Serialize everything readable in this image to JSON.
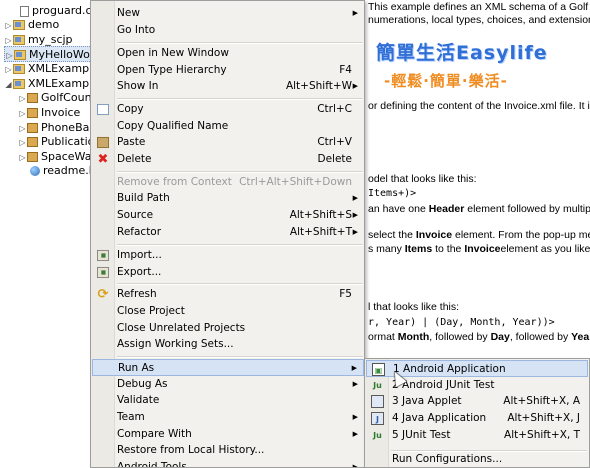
{
  "tree": {
    "items": [
      {
        "label": "proguard.cfg",
        "kind": "file"
      },
      {
        "label": "demo",
        "kind": "project",
        "twisty": "▷"
      },
      {
        "label": "my_scjp",
        "kind": "project",
        "twisty": "▷"
      },
      {
        "label": "MyHelloWorld",
        "kind": "project",
        "twisty": "▷"
      },
      {
        "label": "XMLExample",
        "kind": "project",
        "twisty": "▷"
      },
      {
        "label": "XMLExample",
        "kind": "project",
        "twisty": "◢"
      },
      {
        "label": "GolfCount",
        "kind": "package",
        "twisty": "▷"
      },
      {
        "label": "Invoice",
        "kind": "package",
        "twisty": "▷"
      },
      {
        "label": "PhoneBank",
        "kind": "package",
        "twisty": "▷"
      },
      {
        "label": "Publications",
        "kind": "package",
        "twisty": "▷"
      },
      {
        "label": "SpaceWar",
        "kind": "package",
        "twisty": "▷"
      },
      {
        "label": "readme.htm",
        "kind": "web"
      }
    ]
  },
  "editor": {
    "intro1": "This example defines an XML schema of a Golf Course",
    "intro2": "numerations, local types, choices, and extensions",
    "logo_line1": "簡單生活Easylife",
    "logo_line2": "-輕鬆·簡單·樂活-",
    "para1": "or defining the content of the Invoice.xml file. It is as",
    "para2": "odel that looks like this:",
    "code1": "Items+)>",
    "para3_pre": "an have one ",
    "para3_bold": "Header",
    "para3_post": " element followed by multiple",
    "para4_pre": "select the ",
    "para4_bold": "Invoice",
    "para4_post": " element. From the pop-up menu",
    "para5_pre": "s many ",
    "para5_bold1": "Items",
    "para5_mid": " to the ",
    "para5_bold2": "Invoice",
    "para5_post": "element as you like.",
    "para6": "l that looks like this:",
    "code2": "r, Year) | (Day, Month, Year))>",
    "para7_pre": "ormat ",
    "para7_bold1": "Month",
    "para7_mid": ", followed by ",
    "para7_bold2": "Day",
    "para7_mid2": ", followed by ",
    "para7_bold3": "Year",
    "para7_post": ","
  },
  "context_menu": {
    "items": [
      {
        "label": "New",
        "submenu": true
      },
      {
        "label": "Go Into"
      },
      {
        "label": "Open in New Window"
      },
      {
        "label": "Open Type Hierarchy",
        "shortcut": "F4"
      },
      {
        "label": "Show In",
        "shortcut": "Alt+Shift+W",
        "submenu": true
      },
      {
        "label": "Copy",
        "shortcut": "Ctrl+C",
        "icon": "copy-icon"
      },
      {
        "label": "Copy Qualified Name"
      },
      {
        "label": "Paste",
        "shortcut": "Ctrl+V",
        "icon": "paste-icon"
      },
      {
        "label": "Delete",
        "shortcut": "Delete",
        "icon": "delete-icon"
      },
      {
        "label": "Remove from Context",
        "shortcut": "Ctrl+Alt+Shift+Down",
        "disabled": true
      },
      {
        "label": "Build Path",
        "submenu": true
      },
      {
        "label": "Source",
        "shortcut": "Alt+Shift+S",
        "submenu": true
      },
      {
        "label": "Refactor",
        "shortcut": "Alt+Shift+T",
        "submenu": true
      },
      {
        "label": "Import...",
        "icon": "import-icon"
      },
      {
        "label": "Export...",
        "icon": "export-icon"
      },
      {
        "label": "Refresh",
        "shortcut": "F5",
        "icon": "refresh-icon"
      },
      {
        "label": "Close Project"
      },
      {
        "label": "Close Unrelated Projects"
      },
      {
        "label": "Assign Working Sets..."
      },
      {
        "label": "Run As",
        "submenu": true,
        "highlighted": true
      },
      {
        "label": "Debug As",
        "submenu": true
      },
      {
        "label": "Validate"
      },
      {
        "label": "Team",
        "submenu": true
      },
      {
        "label": "Compare With",
        "submenu": true
      },
      {
        "label": "Restore from Local History..."
      },
      {
        "label": "Android Tools",
        "submenu": true
      }
    ]
  },
  "run_as_menu": {
    "items": [
      {
        "label": "1 Android Application",
        "icon": "android-app-icon",
        "highlighted": true
      },
      {
        "label": "2 Android JUnit Test",
        "icon": "junit-icon"
      },
      {
        "label": "3 Java Applet",
        "shortcut": "Alt+Shift+X, A",
        "icon": "applet-icon"
      },
      {
        "label": "4 Java Application",
        "shortcut": "Alt+Shift+X, J",
        "icon": "java-app-icon"
      },
      {
        "label": "5 JUnit Test",
        "shortcut": "Alt+Shift+X, T",
        "icon": "junit-icon"
      },
      {
        "label": "Run Configurations..."
      }
    ],
    "icon_glyphs": {
      "android": "▣",
      "junit": "Ju",
      "java": "J"
    }
  }
}
